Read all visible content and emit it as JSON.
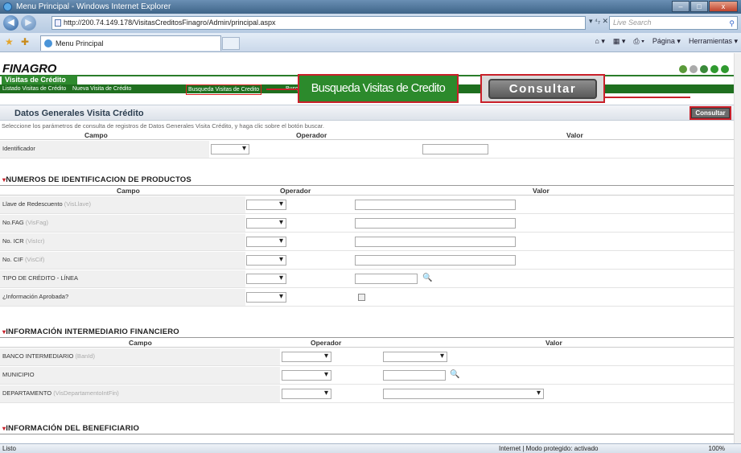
{
  "window": {
    "title": "Menu Principal - Windows Internet Explorer",
    "minimize": "–",
    "maximize": "□",
    "close": "x"
  },
  "addressbar": {
    "url": "http://200.74.149.178/VisitasCreditosFinagro/Admin/principal.aspx",
    "nav_arrows": "▾  ⁴₇  ✕",
    "search_placeholder": "Live Search"
  },
  "tabs": {
    "active_label": "Menu Principal"
  },
  "commandbar": {
    "home": "⌂ ▾",
    "feeds": "▦ ▾",
    "print": "⎙ ▾",
    "pagina": "Página ▾",
    "herramientas": "Herramientas ▾"
  },
  "app": {
    "logo": "FINAGRO",
    "module_tab": "Visitas de Crédito",
    "menu": {
      "listado": "Listado Visitas de Crédito",
      "nueva": "Nueva Visita de Crédito",
      "busqueda": "Busqueda Visitas de Credito",
      "partial": "Busq"
    },
    "callout_busqueda": "Busqueda Visitas de Credito",
    "callout_consultar": "Consultar",
    "section_title": "Datos Generales Visita Crédito",
    "consultar_button": "Consultar",
    "instructions": "Seleccione los parámetros de consulta de registros de Datos Generales Visita Crédito, y haga clic sobre el botón buscar.",
    "headers": {
      "campo": "Campo",
      "operador": "Operador",
      "valor": "Valor"
    },
    "general": {
      "identificador": "Identificador"
    },
    "group1": {
      "title": "NUMEROS DE IDENTIFICACION DE PRODUCTOS",
      "rows": [
        {
          "label": "Llave de Redescuento",
          "sub": "(VisLlave)"
        },
        {
          "label": "No.FAG",
          "sub": "(VisFag)"
        },
        {
          "label": "No. ICR",
          "sub": "(VisIcr)"
        },
        {
          "label": "No. CIF",
          "sub": "(VisCif)"
        },
        {
          "label": "TIPO DE CRÉDITO - LÍNEA",
          "sub": ""
        },
        {
          "label": "¿Información Aprobada?",
          "sub": ""
        }
      ]
    },
    "group2": {
      "title": "INFORMACIÓN INTERMEDIARIO FINANCIERO",
      "rows": [
        {
          "label": "BANCO INTERMEDIARIO",
          "sub": "(BanId)"
        },
        {
          "label": "MUNICIPIO",
          "sub": ""
        },
        {
          "label": "DEPARTAMENTO",
          "sub": "(VisDepartamentoIntFin)"
        }
      ]
    },
    "group3": {
      "title": "INFORMACIÓN DEL BENEFICIARIO"
    }
  },
  "statusbar": {
    "status": "Listo",
    "zone": "Internet | Modo protegido: activado",
    "zoom": "100%"
  },
  "colors": {
    "brand_green": "#1f6f1f",
    "callout_red": "#c9202a"
  }
}
